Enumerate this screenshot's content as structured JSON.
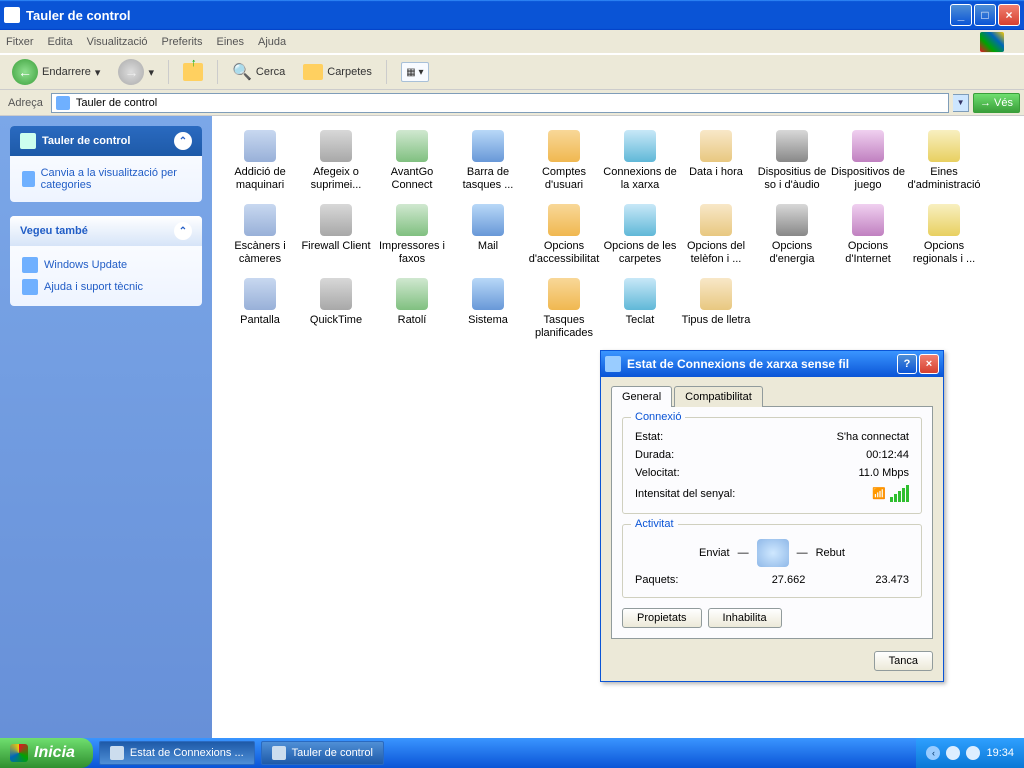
{
  "window": {
    "title": "Tauler de control"
  },
  "menu": {
    "items": [
      "Fitxer",
      "Edita",
      "Visualització",
      "Preferits",
      "Eines",
      "Ajuda"
    ]
  },
  "toolbar": {
    "back": "Endarrere",
    "search": "Cerca",
    "folders": "Carpetes"
  },
  "address": {
    "label": "Adreça",
    "value": "Tauler de control",
    "go": "Vés"
  },
  "sidebar": {
    "panel1": {
      "title": "Tauler de control",
      "link": "Canvia a la visualització per categories"
    },
    "panel2": {
      "title": "Vegeu també",
      "links": [
        "Windows Update",
        "Ajuda i suport tècnic"
      ]
    }
  },
  "cp_items": [
    "Addició de maquinari",
    "Afegeix o suprimei...",
    "AvantGo Connect",
    "Barra de tasques ...",
    "Comptes d'usuari",
    "Connexions de la xarxa",
    "Data i hora",
    "Dispositius de so i d'àudio",
    "Dispositivos de juego",
    "Eines d'administració",
    "Escàners i càmeres",
    "Firewall Client",
    "Impressores i faxos",
    "Mail",
    "Opcions d'accessibilitat",
    "Opcions de les carpetes",
    "Opcions del telèfon i ...",
    "Opcions d'energia",
    "Opcions d'Internet",
    "Opcions regionals i ...",
    "Pantalla",
    "QuickTime",
    "Ratolí",
    "Sistema",
    "Tasques planificades",
    "Teclat",
    "Tipus de lletra"
  ],
  "dialog": {
    "title": "Estat de Connexions de xarxa sense fil",
    "tabs": {
      "general": "General",
      "compat": "Compatibilitat"
    },
    "connection": {
      "group": "Connexió",
      "state_lbl": "Estat:",
      "state_val": "S'ha connectat",
      "dur_lbl": "Durada:",
      "dur_val": "00:12:44",
      "spd_lbl": "Velocitat:",
      "spd_val": "11.0 Mbps",
      "sig_lbl": "Intensitat del senyal:"
    },
    "activity": {
      "group": "Activitat",
      "sent": "Enviat",
      "recv": "Rebut",
      "pkt_lbl": "Paquets:",
      "pkt_sent": "27.662",
      "pkt_recv": "23.473"
    },
    "buttons": {
      "props": "Propietats",
      "disable": "Inhabilita",
      "close": "Tanca"
    }
  },
  "taskbar": {
    "start": "Inicia",
    "tasks": [
      "Estat de Connexions ...",
      "Tauler de control"
    ],
    "clock": "19:34"
  }
}
